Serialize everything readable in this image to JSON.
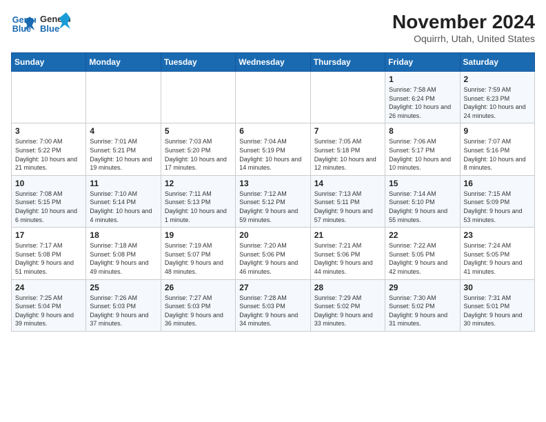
{
  "logo": {
    "line1": "General",
    "line2": "Blue"
  },
  "title": "November 2024",
  "subtitle": "Oquirrh, Utah, United States",
  "weekdays": [
    "Sunday",
    "Monday",
    "Tuesday",
    "Wednesday",
    "Thursday",
    "Friday",
    "Saturday"
  ],
  "weeks": [
    [
      {
        "day": "",
        "info": ""
      },
      {
        "day": "",
        "info": ""
      },
      {
        "day": "",
        "info": ""
      },
      {
        "day": "",
        "info": ""
      },
      {
        "day": "",
        "info": ""
      },
      {
        "day": "1",
        "info": "Sunrise: 7:58 AM\nSunset: 6:24 PM\nDaylight: 10 hours and 26 minutes."
      },
      {
        "day": "2",
        "info": "Sunrise: 7:59 AM\nSunset: 6:23 PM\nDaylight: 10 hours and 24 minutes."
      }
    ],
    [
      {
        "day": "3",
        "info": "Sunrise: 7:00 AM\nSunset: 5:22 PM\nDaylight: 10 hours and 21 minutes."
      },
      {
        "day": "4",
        "info": "Sunrise: 7:01 AM\nSunset: 5:21 PM\nDaylight: 10 hours and 19 minutes."
      },
      {
        "day": "5",
        "info": "Sunrise: 7:03 AM\nSunset: 5:20 PM\nDaylight: 10 hours and 17 minutes."
      },
      {
        "day": "6",
        "info": "Sunrise: 7:04 AM\nSunset: 5:19 PM\nDaylight: 10 hours and 14 minutes."
      },
      {
        "day": "7",
        "info": "Sunrise: 7:05 AM\nSunset: 5:18 PM\nDaylight: 10 hours and 12 minutes."
      },
      {
        "day": "8",
        "info": "Sunrise: 7:06 AM\nSunset: 5:17 PM\nDaylight: 10 hours and 10 minutes."
      },
      {
        "day": "9",
        "info": "Sunrise: 7:07 AM\nSunset: 5:16 PM\nDaylight: 10 hours and 8 minutes."
      }
    ],
    [
      {
        "day": "10",
        "info": "Sunrise: 7:08 AM\nSunset: 5:15 PM\nDaylight: 10 hours and 6 minutes."
      },
      {
        "day": "11",
        "info": "Sunrise: 7:10 AM\nSunset: 5:14 PM\nDaylight: 10 hours and 4 minutes."
      },
      {
        "day": "12",
        "info": "Sunrise: 7:11 AM\nSunset: 5:13 PM\nDaylight: 10 hours and 1 minute."
      },
      {
        "day": "13",
        "info": "Sunrise: 7:12 AM\nSunset: 5:12 PM\nDaylight: 9 hours and 59 minutes."
      },
      {
        "day": "14",
        "info": "Sunrise: 7:13 AM\nSunset: 5:11 PM\nDaylight: 9 hours and 57 minutes."
      },
      {
        "day": "15",
        "info": "Sunrise: 7:14 AM\nSunset: 5:10 PM\nDaylight: 9 hours and 55 minutes."
      },
      {
        "day": "16",
        "info": "Sunrise: 7:15 AM\nSunset: 5:09 PM\nDaylight: 9 hours and 53 minutes."
      }
    ],
    [
      {
        "day": "17",
        "info": "Sunrise: 7:17 AM\nSunset: 5:08 PM\nDaylight: 9 hours and 51 minutes."
      },
      {
        "day": "18",
        "info": "Sunrise: 7:18 AM\nSunset: 5:08 PM\nDaylight: 9 hours and 49 minutes."
      },
      {
        "day": "19",
        "info": "Sunrise: 7:19 AM\nSunset: 5:07 PM\nDaylight: 9 hours and 48 minutes."
      },
      {
        "day": "20",
        "info": "Sunrise: 7:20 AM\nSunset: 5:06 PM\nDaylight: 9 hours and 46 minutes."
      },
      {
        "day": "21",
        "info": "Sunrise: 7:21 AM\nSunset: 5:06 PM\nDaylight: 9 hours and 44 minutes."
      },
      {
        "day": "22",
        "info": "Sunrise: 7:22 AM\nSunset: 5:05 PM\nDaylight: 9 hours and 42 minutes."
      },
      {
        "day": "23",
        "info": "Sunrise: 7:24 AM\nSunset: 5:05 PM\nDaylight: 9 hours and 41 minutes."
      }
    ],
    [
      {
        "day": "24",
        "info": "Sunrise: 7:25 AM\nSunset: 5:04 PM\nDaylight: 9 hours and 39 minutes."
      },
      {
        "day": "25",
        "info": "Sunrise: 7:26 AM\nSunset: 5:03 PM\nDaylight: 9 hours and 37 minutes."
      },
      {
        "day": "26",
        "info": "Sunrise: 7:27 AM\nSunset: 5:03 PM\nDaylight: 9 hours and 36 minutes."
      },
      {
        "day": "27",
        "info": "Sunrise: 7:28 AM\nSunset: 5:03 PM\nDaylight: 9 hours and 34 minutes."
      },
      {
        "day": "28",
        "info": "Sunrise: 7:29 AM\nSunset: 5:02 PM\nDaylight: 9 hours and 33 minutes."
      },
      {
        "day": "29",
        "info": "Sunrise: 7:30 AM\nSunset: 5:02 PM\nDaylight: 9 hours and 31 minutes."
      },
      {
        "day": "30",
        "info": "Sunrise: 7:31 AM\nSunset: 5:01 PM\nDaylight: 9 hours and 30 minutes."
      }
    ]
  ]
}
